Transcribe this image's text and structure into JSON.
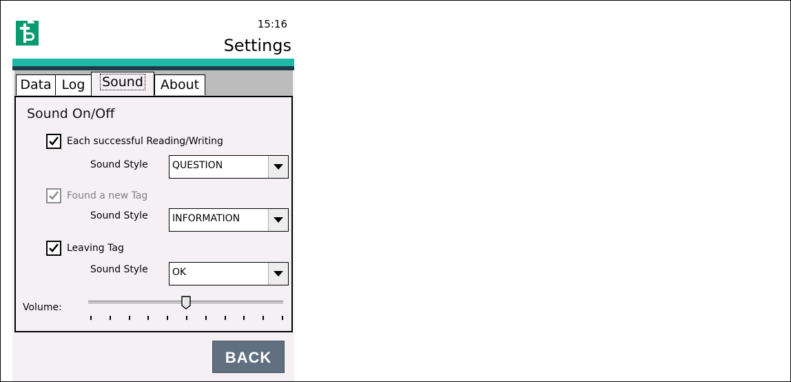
{
  "header": {
    "time": "15:16",
    "title": "Settings",
    "logo_icon": "pf-logo-icon",
    "brand_color": "#0b9a6f",
    "accent_color": "#1fb8a8"
  },
  "tabs": [
    {
      "label": "Data",
      "active": false
    },
    {
      "label": "Log",
      "active": false
    },
    {
      "label": "Sound",
      "active": true
    },
    {
      "label": "About",
      "active": false
    }
  ],
  "sound": {
    "section_title": "Sound On/Off",
    "options": [
      {
        "label": "Each successful Reading/Writing",
        "checked": true,
        "enabled": true,
        "style_label": "Sound Style",
        "style_value": "QUESTION"
      },
      {
        "label": "Found a new Tag",
        "checked": true,
        "enabled": false,
        "style_label": "Sound Style",
        "style_value": "INFORMATION"
      },
      {
        "label": "Leaving Tag",
        "checked": true,
        "enabled": true,
        "style_label": "Sound Style",
        "style_value": "OK"
      }
    ],
    "volume_label": "Volume:",
    "volume_level": 0.5,
    "volume_ticks": 11
  },
  "footer": {
    "back_label": "BACK",
    "back_color": "#607080"
  }
}
